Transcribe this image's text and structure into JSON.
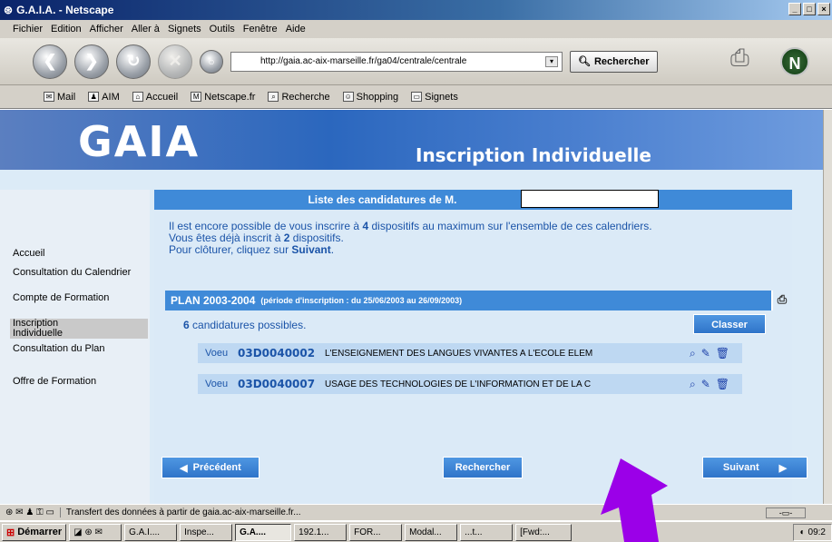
{
  "window": {
    "title": "G.A.I.A. - Netscape",
    "min": "_",
    "max": "□",
    "close": "×"
  },
  "menu": [
    "Fichier",
    "Edition",
    "Afficher",
    "Aller à",
    "Signets",
    "Outils",
    "Fenêtre",
    "Aide"
  ],
  "nav": {
    "url": "http://gaia.ac-aix-marseille.fr/ga04/centrale/centrale",
    "search_label": "Rechercher"
  },
  "personal_bar": [
    "Mail",
    "AIM",
    "Accueil",
    "Netscape.fr",
    "Recherche",
    "Shopping",
    "Signets"
  ],
  "banner": {
    "logo": "GAIA",
    "title": "Inscription Individuelle"
  },
  "sidebar": {
    "items": [
      "Accueil",
      "Consultation du Calendrier",
      "Compte de Formation",
      "Inscription Individuelle",
      "Consultation du Plan",
      "Offre de Formation"
    ],
    "active_index": 3
  },
  "main": {
    "list_title": "Liste des candidatures de M.",
    "info_line1_a": "Il est encore possible de vous inscrire à ",
    "info_line1_n": "4",
    "info_line1_b": " dispositifs au maximum sur l'ensemble de ces calendriers.",
    "info_line2_a": "Vous êtes déjà inscrit à ",
    "info_line2_n": "2",
    "info_line2_b": " dispositifs.",
    "info_line3_a": "Pour clôturer, cliquez sur ",
    "info_line3_b": "Suivant",
    "info_line3_c": ".",
    "plan_title": "PLAN 2003-2004",
    "plan_period": "(période d'inscription : du 25/06/2003 au 26/09/2003)",
    "possible_count": "6",
    "possible_text": " candidatures possibles.",
    "classer_label": "Classer",
    "voeux": [
      {
        "label": "Voeu",
        "code": "03D0040002",
        "title": "L'ENSEIGNEMENT DES LANGUES VIVANTES A L'ECOLE ELEM"
      },
      {
        "label": "Voeu",
        "code": "03D0040007",
        "title": "USAGE DES TECHNOLOGIES DE L'INFORMATION ET DE LA C"
      }
    ],
    "btn_prev": "Précédent",
    "btn_search": "Rechercher",
    "btn_next": "Suivant"
  },
  "status": {
    "text": "Transfert des données à partir de gaia.ac-aix-marseille.fr..."
  },
  "taskbar": {
    "start": "Démarrer",
    "items": [
      "G.A.I....",
      "Inspe...",
      "G.A....",
      "192.1...",
      "FOR...",
      "Modal...",
      "...t...",
      "[Fwd:..."
    ],
    "active_index": 2,
    "clock": "09:2"
  },
  "colors": {
    "accent": "#3f8ad8",
    "text_blue": "#1b54a8",
    "annotation_arrow": "#9b00e8"
  }
}
